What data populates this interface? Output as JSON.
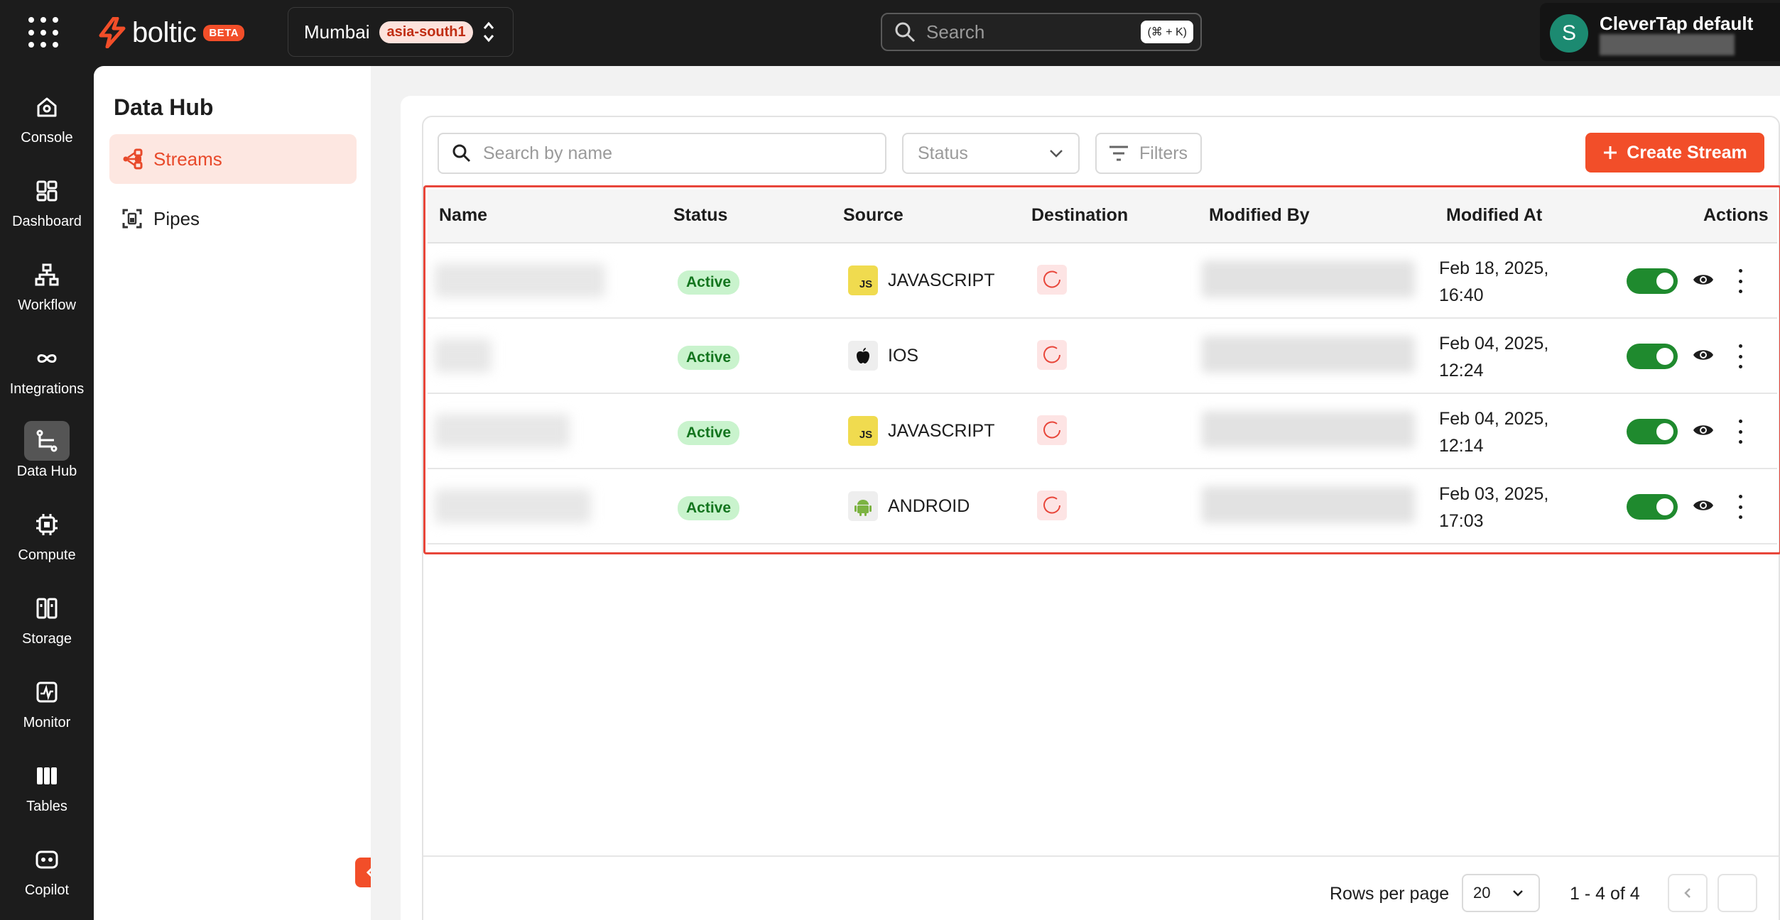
{
  "topbar": {
    "logo_text": "boltic",
    "beta_label": "BETA",
    "region_name": "Mumbai",
    "region_code": "asia-south1",
    "search_placeholder": "Search",
    "search_shortcut": "(⌘ + K)",
    "account_initial": "S",
    "account_name": "CleverTap default"
  },
  "rail": {
    "items": [
      {
        "label": "Console",
        "icon": "home-icon"
      },
      {
        "label": "Dashboard",
        "icon": "dashboard-icon"
      },
      {
        "label": "Workflow",
        "icon": "workflow-icon"
      },
      {
        "label": "Integrations",
        "icon": "infinity-icon"
      },
      {
        "label": "Data Hub",
        "icon": "data-hub-icon",
        "active": true
      },
      {
        "label": "Compute",
        "icon": "chip-icon"
      },
      {
        "label": "Storage",
        "icon": "storage-icon"
      },
      {
        "label": "Monitor",
        "icon": "monitor-icon"
      },
      {
        "label": "Tables",
        "icon": "tables-icon"
      },
      {
        "label": "Copilot",
        "icon": "copilot-icon"
      }
    ]
  },
  "subnav": {
    "title": "Data Hub",
    "items": [
      {
        "label": "Streams",
        "icon": "streams-icon",
        "active": true
      },
      {
        "label": "Pipes",
        "icon": "pipes-icon"
      }
    ]
  },
  "toolbar": {
    "search_placeholder": "Search by name",
    "status_placeholder": "Status",
    "filters_label": "Filters",
    "create_label": "Create Stream"
  },
  "table": {
    "headers": [
      "Name",
      "Status",
      "Source",
      "Destination",
      "Modified By",
      "Modified At",
      "Actions"
    ],
    "rows": [
      {
        "status": "Active",
        "source": "JAVASCRIPT",
        "source_icon": "javascript-icon",
        "modified_at_date": "Feb 18, 2025,",
        "modified_at_time": "16:40"
      },
      {
        "status": "Active",
        "source": "IOS",
        "source_icon": "apple-icon",
        "modified_at_date": "Feb 04, 2025,",
        "modified_at_time": "12:24"
      },
      {
        "status": "Active",
        "source": "JAVASCRIPT",
        "source_icon": "javascript-icon",
        "modified_at_date": "Feb 04, 2025,",
        "modified_at_time": "12:14"
      },
      {
        "status": "Active",
        "source": "ANDROID",
        "source_icon": "android-icon",
        "modified_at_date": "Feb 03, 2025,",
        "modified_at_time": "17:03"
      }
    ]
  },
  "pagination": {
    "rows_per_page_label": "Rows per page",
    "rows_per_page_value": "20",
    "range": "1 - 4 of 4"
  },
  "colors": {
    "accent": "#f24e29",
    "active_badge_bg": "#c9f3cd",
    "toggle_on": "#1f8a2e",
    "highlight_border": "#e8463a"
  }
}
